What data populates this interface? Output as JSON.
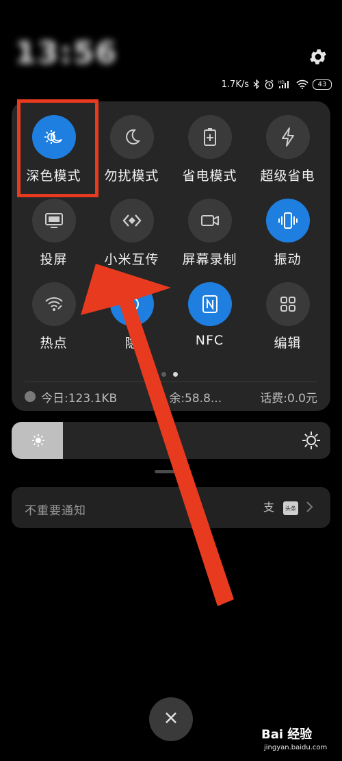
{
  "header": {
    "time": "13:56",
    "date": "",
    "net_speed": "1.7K/s",
    "battery": "43"
  },
  "tiles": [
    {
      "label": "深色模式",
      "icon": "dark-mode-icon",
      "active": true
    },
    {
      "label": "勿扰模式",
      "icon": "moon-icon",
      "active": false
    },
    {
      "label": "省电模式",
      "icon": "battery-saver-icon",
      "active": false
    },
    {
      "label": "超级省电",
      "icon": "lightning-icon",
      "active": false
    },
    {
      "label": "投屏",
      "icon": "cast-icon",
      "active": false
    },
    {
      "label": "小米互传",
      "icon": "mi-share-icon",
      "active": false
    },
    {
      "label": "屏幕录制",
      "icon": "screen-record-icon",
      "active": false
    },
    {
      "label": "振动",
      "icon": "vibrate-icon",
      "active": true
    },
    {
      "label": "热点",
      "icon": "hotspot-icon",
      "active": false
    },
    {
      "label": "隐",
      "icon": "partially-hidden-icon",
      "active": true
    },
    {
      "label": "NFC",
      "icon": "nfc-icon",
      "active": true
    },
    {
      "label": "编辑",
      "icon": "grid-edit-icon",
      "active": false
    }
  ],
  "usage": {
    "today": "今日:123.1KB",
    "remaining": "余:58.8...",
    "fee": "话费:0.0元"
  },
  "brightness": {
    "level": 0.16
  },
  "notification": {
    "text": "不重要通知",
    "app_chip": "头条"
  },
  "watermark": {
    "brand": "Bai 经验",
    "url": "jingyan.baidu.com"
  },
  "colors": {
    "accent": "#1f7fe0",
    "annotation": "#e83a1e",
    "panel": "#262626"
  }
}
